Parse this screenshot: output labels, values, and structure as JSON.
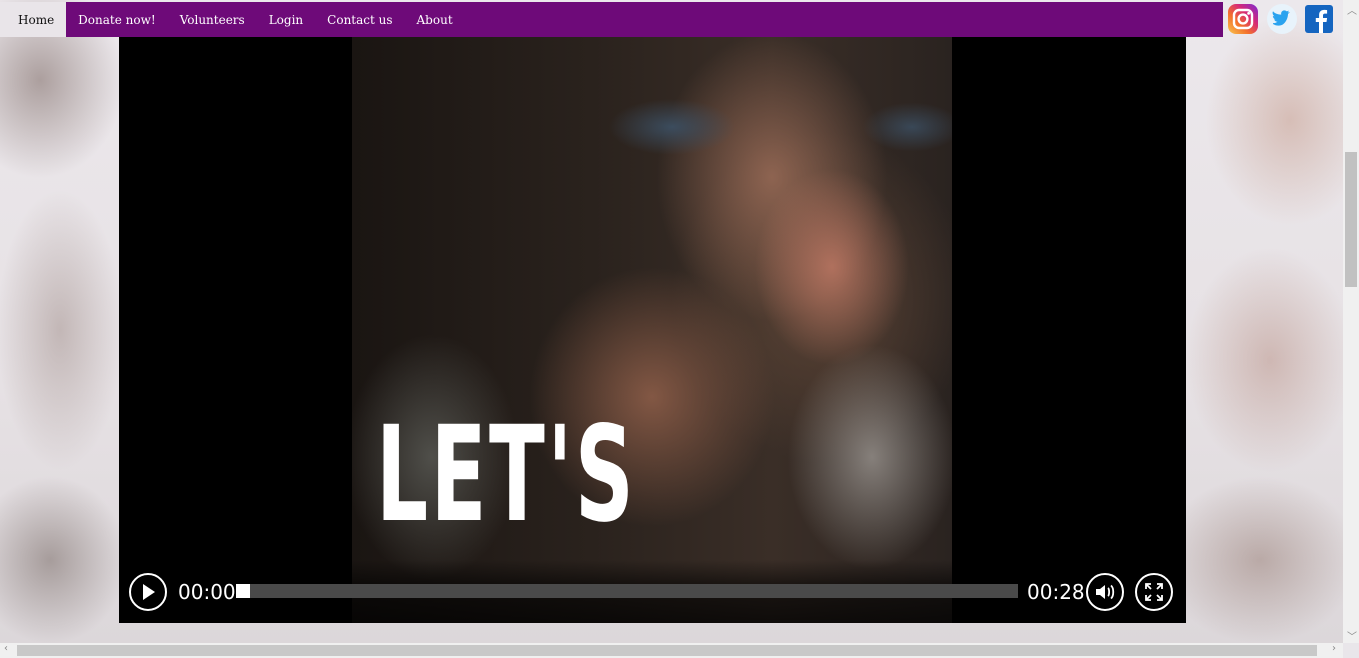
{
  "nav": {
    "items": [
      {
        "label": "Home",
        "active": true
      },
      {
        "label": "Donate now!"
      },
      {
        "label": "Volunteers"
      },
      {
        "label": "Login"
      },
      {
        "label": "Contact us"
      },
      {
        "label": "About"
      }
    ],
    "background_color": "#6e0a79"
  },
  "social": [
    {
      "icon": "instagram-icon"
    },
    {
      "icon": "twitter-icon"
    },
    {
      "icon": "facebook-icon"
    }
  ],
  "video": {
    "poster_text": "LET'S",
    "current_time": "00:00",
    "duration": "00:28",
    "progress": 0
  }
}
